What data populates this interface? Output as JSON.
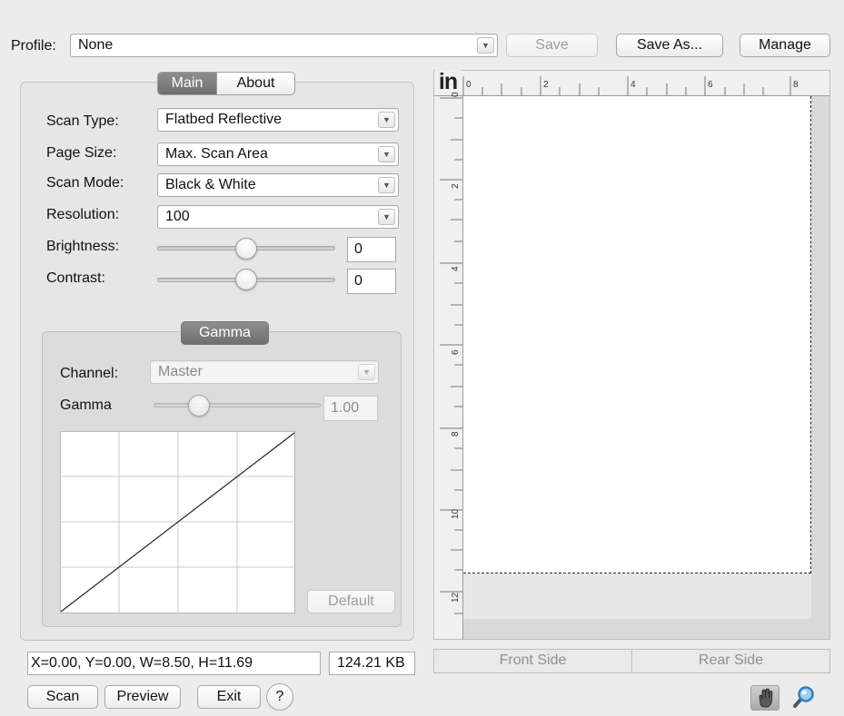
{
  "profile": {
    "label": "Profile:",
    "value": "None",
    "save_label": "Save",
    "save_as_label": "Save As...",
    "manage_label": "Manage"
  },
  "tabs": [
    {
      "label": "Main",
      "active": true
    },
    {
      "label": "About",
      "active": false
    }
  ],
  "settings": {
    "scan_type_label": "Scan Type:",
    "scan_type_value": "Flatbed Reflective",
    "page_size_label": "Page Size:",
    "page_size_value": "Max. Scan Area",
    "scan_mode_label": "Scan Mode:",
    "scan_mode_value": "Black & White",
    "resolution_label": "Resolution:",
    "resolution_value": "100",
    "brightness_label": "Brightness:",
    "brightness_value": "0",
    "brightness_level": 0.5,
    "contrast_label": "Contrast:",
    "contrast_value": "0",
    "contrast_level": 0.5
  },
  "gamma": {
    "title": "Gamma",
    "channel_label": "Channel:",
    "channel_value": "Master",
    "gamma_label": "Gamma",
    "gamma_value": "1.00",
    "default_label": "Default"
  },
  "ruler": {
    "unit_label": "in",
    "top_labels": [
      "0",
      "2",
      "4",
      "6",
      "8"
    ],
    "side_labels": [
      "0",
      "2",
      "4",
      "6",
      "8",
      "10",
      "12"
    ]
  },
  "status": {
    "coords": "X=0.00, Y=0.00, W=8.50, H=11.69",
    "size": "124.21 KB"
  },
  "side_tabs": {
    "front_label": "Front Side",
    "rear_label": "Rear Side"
  },
  "buttons": {
    "scan_label": "Scan",
    "preview_label": "Preview",
    "exit_label": "Exit",
    "help_label": "?"
  },
  "colors": {
    "window_bg": "#ececec",
    "active_tab": "#7f7f7f",
    "preview_bg": "#ffffff"
  }
}
